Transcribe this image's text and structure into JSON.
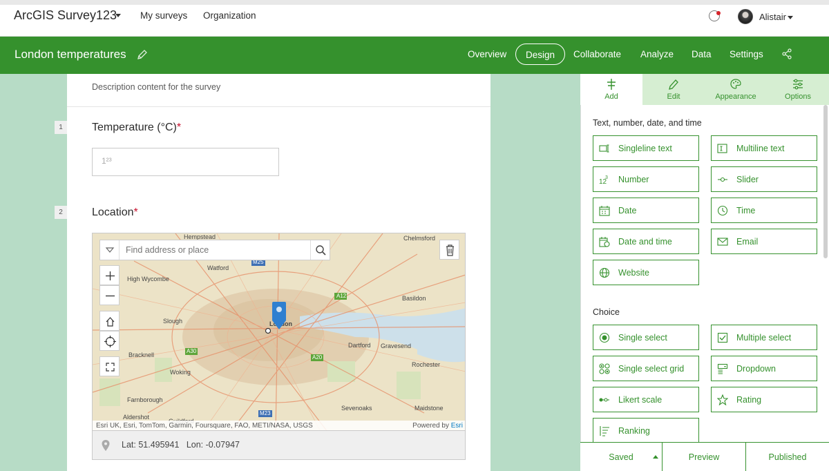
{
  "app": {
    "brand": "ArcGIS Survey123",
    "nav": [
      "My surveys",
      "Organization"
    ],
    "user": "Alistair"
  },
  "header": {
    "title": "London temperatures",
    "tabs": [
      "Overview",
      "Design",
      "Collaborate",
      "Analyze",
      "Data",
      "Settings"
    ],
    "active_tab": "Design"
  },
  "form": {
    "description": "Description content for the survey",
    "questions": [
      {
        "num": "1",
        "label": "Temperature (°C)",
        "required": "*",
        "placeholder": "1²³"
      },
      {
        "num": "2",
        "label": "Location",
        "required": "*"
      }
    ],
    "map": {
      "search_placeholder": "Find address or place",
      "places": [
        "Hempstead",
        "Chelmsford",
        "Watford",
        "High Wycombe",
        "Slough",
        "London",
        "Basildon",
        "Dartford",
        "Gravesend",
        "Bracknell",
        "Rochester",
        "Woking",
        "Farnborough",
        "Sevenoaks",
        "Maidstone",
        "Aldershot",
        "Guildford"
      ],
      "roads": [
        "M25",
        "A12",
        "A30",
        "A20",
        "M23"
      ],
      "attribution": "Esri UK, Esri, TomTom, Garmin, Foursquare, FAO, METI/NASA, USGS",
      "powered_by": "Powered by",
      "powered_brand": "Esri"
    },
    "coordinates": "Lat: 51.495941   Lon: -0.07947"
  },
  "panel": {
    "tabs": [
      "Add",
      "Edit",
      "Appearance",
      "Options"
    ],
    "active_tab": "Add",
    "section_text": "Text, number, date, and time",
    "text_items": [
      "Singleline text",
      "Multiline text",
      "Number",
      "Slider",
      "Date",
      "Time",
      "Date and time",
      "Email",
      "Website"
    ],
    "section_choice": "Choice",
    "choice_items": [
      "Single select",
      "Multiple select",
      "Single select grid",
      "Dropdown",
      "Likert scale",
      "Rating",
      "Ranking"
    ]
  },
  "footer": {
    "saved": "Saved",
    "preview": "Preview",
    "published": "Published"
  },
  "colors": {
    "accent": "#35912d",
    "canvas": "#b7dcc6",
    "required": "#c8102e",
    "pin": "#2f7fd0"
  }
}
